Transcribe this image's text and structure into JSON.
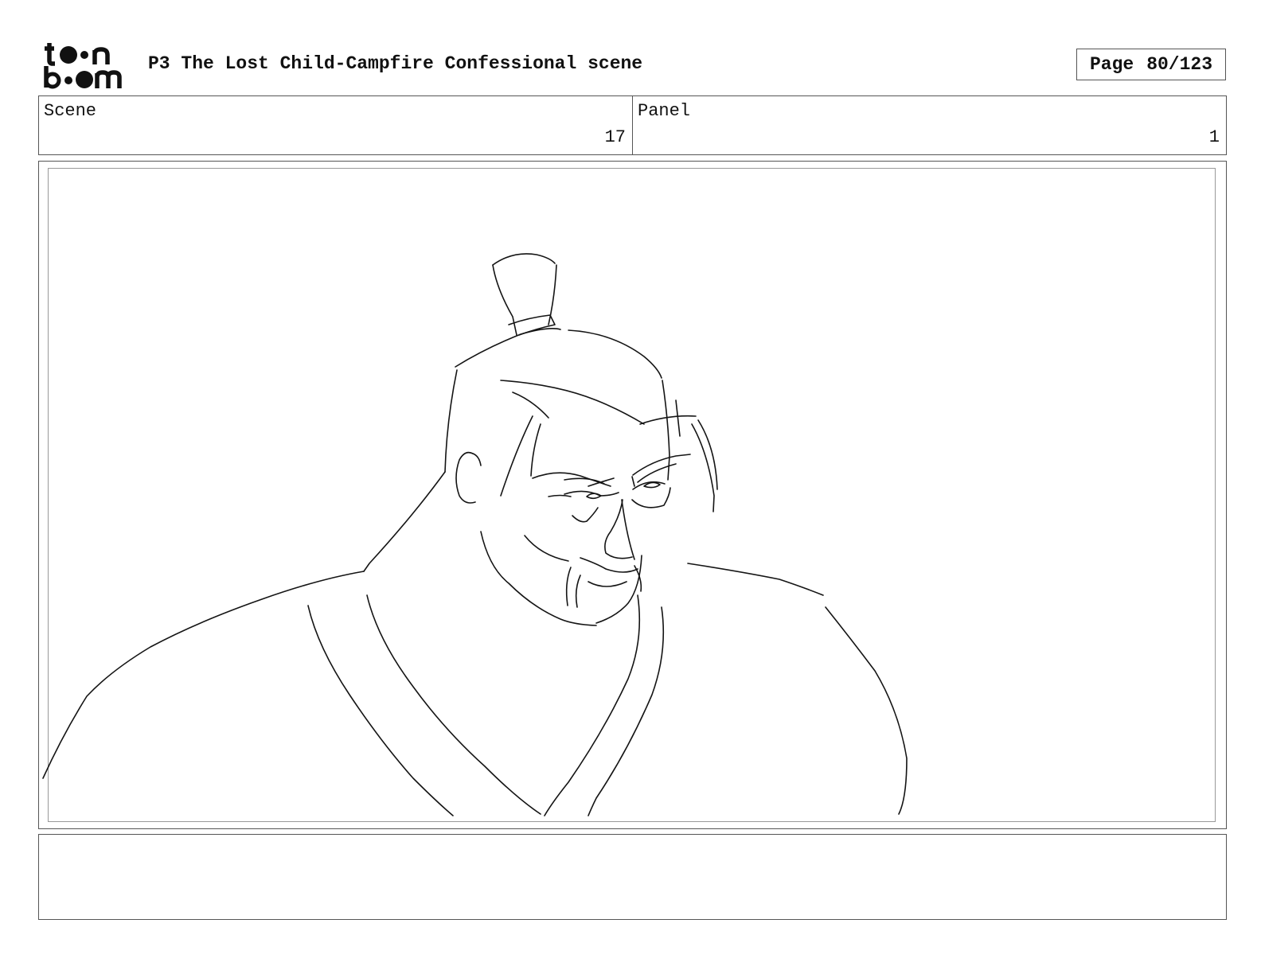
{
  "header": {
    "logo_line1": "toon",
    "logo_line2": "boom",
    "title": "P3 The Lost Child-Campfire Confessional scene",
    "page_label": "Page",
    "page_value": "80/123"
  },
  "info": {
    "scene_label": "Scene",
    "scene_value": "17",
    "panel_label": "Panel",
    "panel_value": "1"
  },
  "notes": {
    "text": ""
  }
}
